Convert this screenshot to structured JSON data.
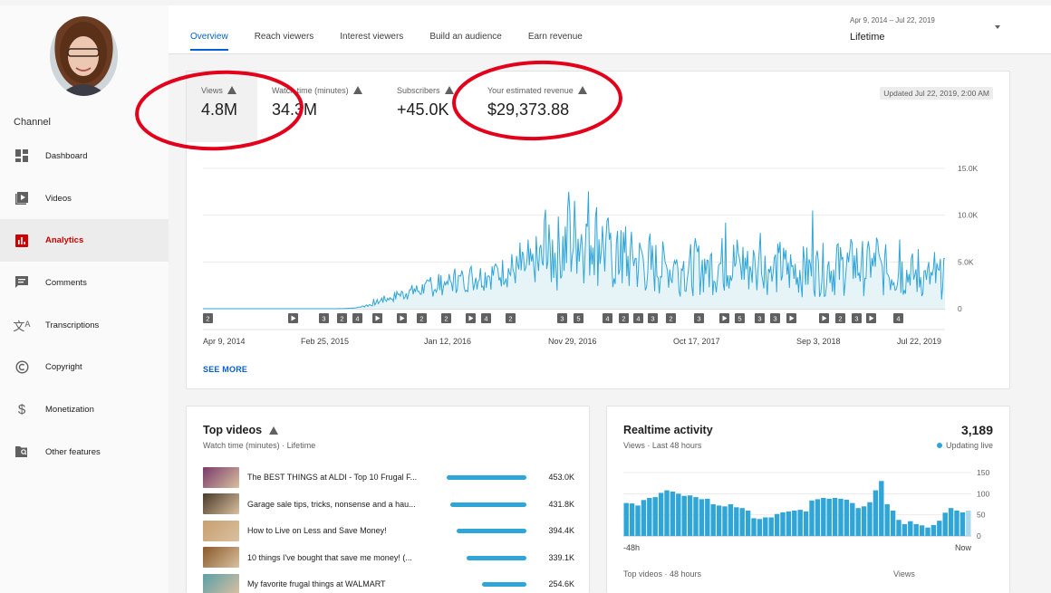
{
  "sidebar": {
    "channel_label": "Channel",
    "items": [
      {
        "name": "dashboard",
        "label": "Dashboard",
        "icon": "dashboard-icon",
        "active": false
      },
      {
        "name": "videos",
        "label": "Videos",
        "icon": "video-library-icon",
        "active": false
      },
      {
        "name": "analytics",
        "label": "Analytics",
        "icon": "analytics-icon",
        "active": true
      },
      {
        "name": "comments",
        "label": "Comments",
        "icon": "comment-icon",
        "active": false
      },
      {
        "name": "transcriptions",
        "label": "Transcriptions",
        "icon": "translate-icon",
        "active": false
      },
      {
        "name": "copyright",
        "label": "Copyright",
        "icon": "copyright-icon",
        "active": false
      },
      {
        "name": "monetization",
        "label": "Monetization",
        "icon": "dollar-icon",
        "active": false
      },
      {
        "name": "other-features",
        "label": "Other features",
        "icon": "folder-search-icon",
        "active": false
      }
    ]
  },
  "tabs": [
    {
      "label": "Overview",
      "active": true
    },
    {
      "label": "Reach viewers",
      "active": false
    },
    {
      "label": "Interest viewers",
      "active": false
    },
    {
      "label": "Build an audience",
      "active": false
    },
    {
      "label": "Earn revenue",
      "active": false
    }
  ],
  "date_range": {
    "range_text": "Apr 9, 2014 – Jul 22, 2019",
    "selected": "Lifetime"
  },
  "metrics": [
    {
      "label": "Views",
      "value": "4.8M",
      "warning": true,
      "active": true
    },
    {
      "label": "Watch time (minutes)",
      "value": "34.3M",
      "warning": true,
      "active": false
    },
    {
      "label": "Subscribers",
      "value": "+45.0K",
      "warning": true,
      "active": false
    },
    {
      "label": "Your estimated revenue",
      "value": "$29,373.88",
      "warning": true,
      "active": false
    }
  ],
  "updated_text": "Updated Jul 22, 2019, 2:00 AM",
  "see_more": "SEE MORE",
  "colors": {
    "accent_blue": "#065fd4",
    "chart_line": "#2fa5d8",
    "chart_fill": "#e6f4f8",
    "analytics_red": "#cc0000",
    "annotation_red": "#e3001b"
  },
  "chart_data": [
    {
      "type": "area",
      "y_tick_labels": [
        "15.0K",
        "10.0K",
        "5.0K",
        "0"
      ],
      "ylim": [
        0,
        15000
      ],
      "x_tick_labels": [
        "Apr 9, 2014",
        "Feb 25, 2015",
        "Jan 12, 2016",
        "Nov 29, 2016",
        "Oct 17, 2017",
        "Sep 3, 2018",
        "Jul 22, 2019"
      ],
      "grid": true,
      "series": [
        {
          "values_by_period": [
            0,
            0,
            0,
            0,
            0,
            0,
            0,
            0,
            0,
            0,
            0,
            10,
            100,
            400,
            900,
            1300,
            1700,
            2000,
            2300,
            2700,
            3000,
            3300,
            3500,
            3800,
            4000,
            4300,
            4600,
            5300,
            6200,
            7400,
            8200,
            7000,
            5500,
            5100,
            4900,
            4500,
            4300,
            4300,
            4400,
            4500,
            4600,
            4700,
            4800,
            4500,
            4300,
            4200,
            4100,
            4000,
            4100,
            4200,
            4300,
            4600,
            4300,
            4000,
            3900,
            3700,
            3500,
            3200,
            3200
          ],
          "peaks": [
            12500,
            10600,
            8400,
            9100,
            10500,
            9200,
            7600,
            8100,
            7400,
            6900
          ]
        }
      ],
      "event_markers": [
        "2",
        "▶",
        "3",
        "2",
        "4",
        "▶",
        "▶",
        "2",
        "2",
        "▶",
        "4",
        "2",
        "3",
        "5",
        "4",
        "2",
        "4",
        "3",
        "2",
        "3",
        "▶",
        "5",
        "3",
        "3",
        "▶",
        "▶",
        "2",
        "3",
        "▶",
        "4"
      ]
    },
    {
      "type": "bar",
      "title": "Realtime activity",
      "y_tick_labels": [
        "150",
        "100",
        "50",
        "0"
      ],
      "ylim": [
        0,
        150
      ],
      "x_tick_labels": [
        "-48h",
        "Now"
      ],
      "values": [
        78,
        77,
        72,
        85,
        90,
        92,
        102,
        108,
        105,
        100,
        95,
        96,
        92,
        87,
        88,
        75,
        72,
        70,
        75,
        68,
        66,
        60,
        42,
        40,
        44,
        44,
        52,
        56,
        58,
        60,
        62,
        58,
        84,
        87,
        90,
        88,
        90,
        88,
        86,
        78,
        66,
        70,
        80,
        108,
        130,
        75,
        60,
        38,
        28,
        35,
        28,
        25,
        20,
        26,
        36,
        55,
        66,
        60,
        56,
        60
      ]
    }
  ],
  "top_videos": {
    "title": "Top videos",
    "subtitle": "Watch time (minutes) · Lifetime",
    "items": [
      {
        "title": "The BEST THINGS at ALDI - Top 10 Frugal F...",
        "value": "453.0K",
        "fraction": 1.0,
        "thumb": "#7a3a6a"
      },
      {
        "title": "Garage sale tips, tricks, nonsense and a hau...",
        "value": "431.8K",
        "fraction": 0.953,
        "thumb": "#4a3a2a"
      },
      {
        "title": "How to Live on Less and Save Money!",
        "value": "394.4K",
        "fraction": 0.871,
        "thumb": "#c8a070"
      },
      {
        "title": "10 things I've bought that save me money! (...",
        "value": "339.1K",
        "fraction": 0.749,
        "thumb": "#8a5a2a"
      },
      {
        "title": "My favorite frugal things at WALMART",
        "value": "254.6K",
        "fraction": 0.562,
        "thumb": "#5aa0a8"
      }
    ]
  },
  "realtime": {
    "title": "Realtime activity",
    "subtitle": "Views · Last 48 hours",
    "count": "3,189",
    "live_text": "Updating live",
    "footer_left": "Top videos · 48 hours",
    "footer_right": "Views"
  }
}
